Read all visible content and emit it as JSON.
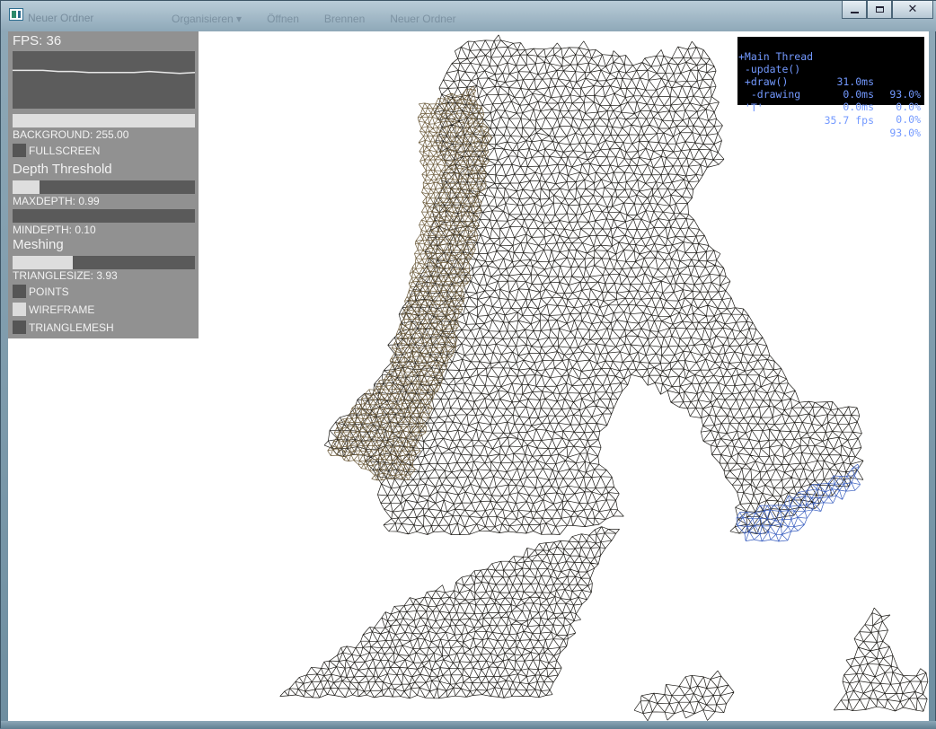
{
  "window": {
    "ghost_title": "Neuer Ordner",
    "ghost_toolbar": [
      "Organisieren ▾",
      "Öffnen",
      "Brennen",
      "Neuer Ordner"
    ],
    "minimize_icon": "minimize-icon",
    "maximize_icon": "maximize-icon",
    "close_glyph": "✕"
  },
  "gui": {
    "fps_label": "FPS:  36",
    "fps_history": [
      0.38,
      0.38,
      0.38,
      0.37,
      0.37,
      0.36,
      0.36,
      0.36,
      0.36,
      0.37,
      0.36,
      0.35,
      0.36
    ],
    "background": {
      "label": "BACKGROUND:  255.00",
      "value": 1.0
    },
    "fullscreen": {
      "label": "FULLSCREEN",
      "checked": false
    },
    "depth_header": "Depth  Threshold",
    "maxdepth": {
      "label": "MAXDEPTH:  0.99",
      "value": 0.15
    },
    "mindepth": {
      "label": "MINDEPTH:  0.10",
      "value": 0.0
    },
    "meshing_header": "Meshing",
    "trianglesize": {
      "label": "TRIANGLESIZE:  3.93",
      "value": 0.33
    },
    "points": {
      "label": "POINTS",
      "checked": false
    },
    "wireframe": {
      "label": "WIREFRAME",
      "checked": true
    },
    "trianglemesh": {
      "label": "TRIANGLEMESH",
      "checked": false
    }
  },
  "profiler": {
    "rows": [
      {
        "name": "+Main Thread",
        "ms": "",
        "pct": ""
      },
      {
        "name": " -update()",
        "ms": "31.0ms",
        "pct": "93.0%"
      },
      {
        "name": " +draw()",
        "ms": "0.0ms",
        "pct": "0.0%"
      },
      {
        "name": "  -drawing",
        "ms": "0.0ms",
        "pct": "0.0%"
      },
      {
        "name": " 'T'",
        "ms": "35.7 fps",
        "pct": "93.0%"
      }
    ]
  },
  "colors": {
    "profiler_text": "#7399ff",
    "mesh_dark": "#1c1a16",
    "mesh_warm": "#6b5a3a",
    "mesh_blue": "#3a5fc0"
  }
}
